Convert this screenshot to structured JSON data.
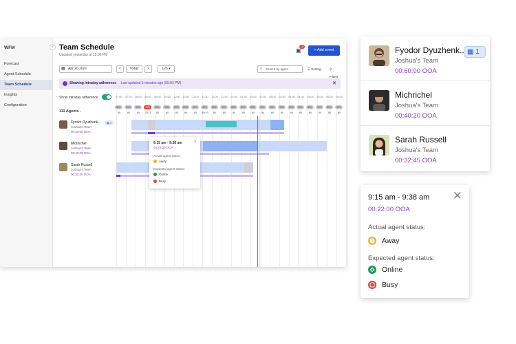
{
  "sidebar": {
    "brand": "WFM",
    "collapse": "«",
    "items": [
      {
        "label": "Forecast"
      },
      {
        "label": "Agent Schedule"
      },
      {
        "label": "Team Schedule"
      },
      {
        "label": "Insights"
      },
      {
        "label": "Configuration"
      }
    ],
    "active_index": 2
  },
  "header": {
    "title": "Team Schedule",
    "subtitle": "Updated yesterday at 12:00 PM",
    "notification_count": "10",
    "add_event_label": "+ Add event"
  },
  "toolbar": {
    "date": "Apr 20 2021",
    "prev": "<",
    "today": "Today",
    "next": ">",
    "range": "12h ▾",
    "search_placeholder": "Search by agent",
    "sorting": "Sorting",
    "filters": "Filters"
  },
  "banner": {
    "title": "Showing intraday adherence",
    "updated": "Last updated 5 minutes ago (05:03 PM)",
    "close": "✕"
  },
  "adherence_toggle": {
    "label": "Show intraday adherence",
    "on": true
  },
  "agents_count": "111 Agents",
  "timeline": {
    "times": [
      "07:00",
      "07:30",
      "08:00",
      "08:30",
      "09:00",
      "09:30",
      "10:00",
      "10:30",
      "11:00",
      "11:30",
      "12:00",
      "12:30",
      "01:00",
      "01:30",
      "02:00",
      "02:30",
      "03:00",
      "03:30",
      "04:00",
      "04:30",
      "05:00",
      "05:30",
      "06:00",
      "06:30"
    ],
    "pills": [
      "80%",
      "90%",
      "90%",
      "76%",
      "80%",
      "90%",
      "90%",
      "100%",
      "90%",
      "90%",
      "80%",
      "90%",
      "80%",
      "90%",
      "80%",
      "90%",
      "80%",
      "90%",
      "80%",
      "90%",
      "80%",
      "90%",
      "80%",
      "90%"
    ],
    "counts": [
      "80",
      "80",
      "80",
      "76/-3",
      "80",
      "80",
      "80",
      "80",
      "80",
      "45/+3",
      "80",
      "80",
      "80",
      "80",
      "80",
      "80",
      "80",
      "80",
      "80",
      "80",
      "80",
      "80",
      "80",
      "80"
    ]
  },
  "agents": [
    {
      "name": "Fyodor Dyuzhenk...",
      "team": "Joshua's Team",
      "ooa": "00:40:00 OOA",
      "badge": "1"
    },
    {
      "name": "Michrichel",
      "team": "Joshua's Team",
      "ooa": "00:40:20 OOA"
    },
    {
      "name": "Sarah Russell",
      "team": "Joshua's Team",
      "ooa": "00:32:45 OOA"
    }
  ],
  "mini_popup": {
    "time": "9:15 am - 9:38 am",
    "ooa": "00:22:00 OOA",
    "actual_label": "Actual agent status:",
    "actual": "Away",
    "expected_label": "Expected agent status:",
    "expected": [
      "Online",
      "Busy"
    ]
  },
  "zoom_agents": [
    {
      "name": "Fyodor Dyuzhenk...",
      "team": "Joshua's Team",
      "ooa": "00:60:00 OOA",
      "badge": "1"
    },
    {
      "name": "Michrichel",
      "team": "Joshua's Team",
      "ooa": "00:40:20 OOA"
    },
    {
      "name": "Sarah Russell",
      "team": "Joshua's Team",
      "ooa": "00:32:45 OOA"
    }
  ],
  "status_popup": {
    "time": "9:15 am - 9:38 am",
    "ooa": "00:22:00 OOA",
    "actual_label": "Actual agent status:",
    "actual": "Away",
    "expected_label": "Expected agent status:",
    "expected_online": "Online",
    "expected_busy": "Busy",
    "close": "✕"
  },
  "colors": {
    "accent": "#2453d4",
    "ooa": "#8a3fc7",
    "away": "#e6b83a",
    "online": "#1f9a5a",
    "busy": "#d24a3a"
  }
}
